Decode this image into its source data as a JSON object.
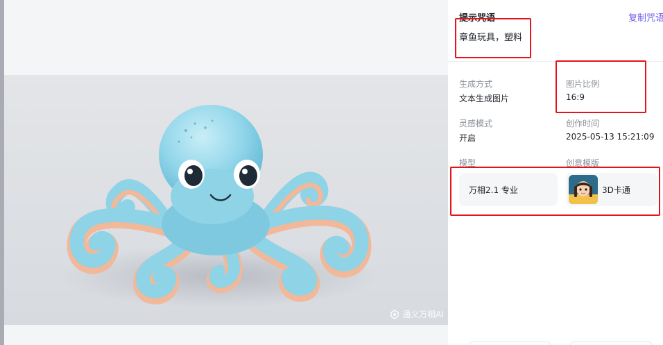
{
  "watermark": {
    "text": "通义万相AI"
  },
  "prompt": {
    "title": "提示咒语",
    "copy_label": "复制咒语",
    "text": "章鱼玩具，塑料"
  },
  "meta": {
    "generation_method": {
      "label": "生成方式",
      "value": "文本生成图片"
    },
    "aspect_ratio": {
      "label": "图片比例",
      "value": "16:9"
    },
    "inspiration_mode": {
      "label": "灵感模式",
      "value": "开启"
    },
    "created_time": {
      "label": "创作时间",
      "value": "2025-05-13 15:21:09"
    },
    "model": {
      "label": "模型",
      "value": "万相2.1 专业"
    },
    "template": {
      "label": "创意模版",
      "value": "3D卡通"
    }
  },
  "colors": {
    "accent": "#6e5ff0",
    "highlight": "#e3141b",
    "octopus": "#8fd3e6"
  },
  "icons": {
    "watermark": "swirl-logo-icon",
    "template_avatar": "cartoon-girl-avatar"
  }
}
